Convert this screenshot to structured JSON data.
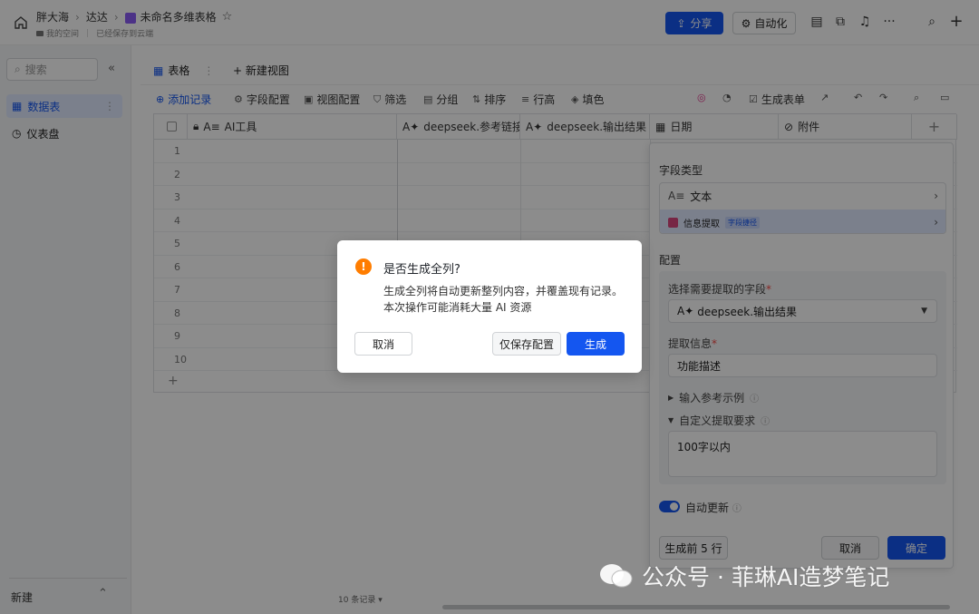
{
  "topbar": {
    "breadcrumb": [
      "胖大海",
      "达达",
      "未命名多维表格"
    ],
    "space": "我的空间",
    "save_status": "已经保存到云端",
    "share_label": "分享",
    "automation_label": "自动化"
  },
  "sidebar": {
    "search_placeholder": "搜索",
    "items": [
      {
        "label": "数据表"
      },
      {
        "label": "仪表盘"
      }
    ],
    "new_label": "新建"
  },
  "view_tabs": {
    "table_label": "表格",
    "new_view_label": "新建视图"
  },
  "toolbar": {
    "add_record": "添加记录",
    "field_config": "字段配置",
    "view_config": "视图配置",
    "filter": "筛选",
    "group": "分组",
    "sort": "排序",
    "row_height": "行高",
    "fill_color": "填色",
    "generate_form": "生成表单"
  },
  "grid": {
    "columns": [
      "AI工具",
      "deepseek.参考链接",
      "deepseek.输出结果",
      "日期",
      "附件"
    ],
    "rows": [
      "1",
      "2",
      "3",
      "4",
      "5",
      "6",
      "7",
      "8",
      "9",
      "10"
    ]
  },
  "panel": {
    "field_type_title": "字段类型",
    "text_type": "文本",
    "extract_type": "信息提取",
    "extract_tag": "字段捷径",
    "config_title": "配置",
    "select_field_label": "选择需要提取的字段",
    "select_field_value": "deepseek.输出结果",
    "extract_info_label": "提取信息",
    "extract_info_value": "功能描述",
    "ref_example_label": "输入参考示例",
    "custom_req_label": "自定义提取要求",
    "custom_req_value": "100字以内",
    "auto_update_label": "自动更新",
    "generate_first_label": "生成前 5 行",
    "cancel_label": "取消",
    "confirm_label": "确定"
  },
  "footer": {
    "record_count": "10 条记录"
  },
  "modal": {
    "title": "是否生成全列?",
    "body": "生成全列将自动更新整列内容，并覆盖现有记录。本次操作可能消耗大量 AI 资源",
    "cancel_label": "取消",
    "save_only_label": "仅保存配置",
    "generate_label": "生成"
  },
  "watermark": {
    "text": "公众号 · 菲琳AI造梦笔记"
  },
  "colors": {
    "primary": "#1456f0",
    "warning": "#ff7d00"
  }
}
